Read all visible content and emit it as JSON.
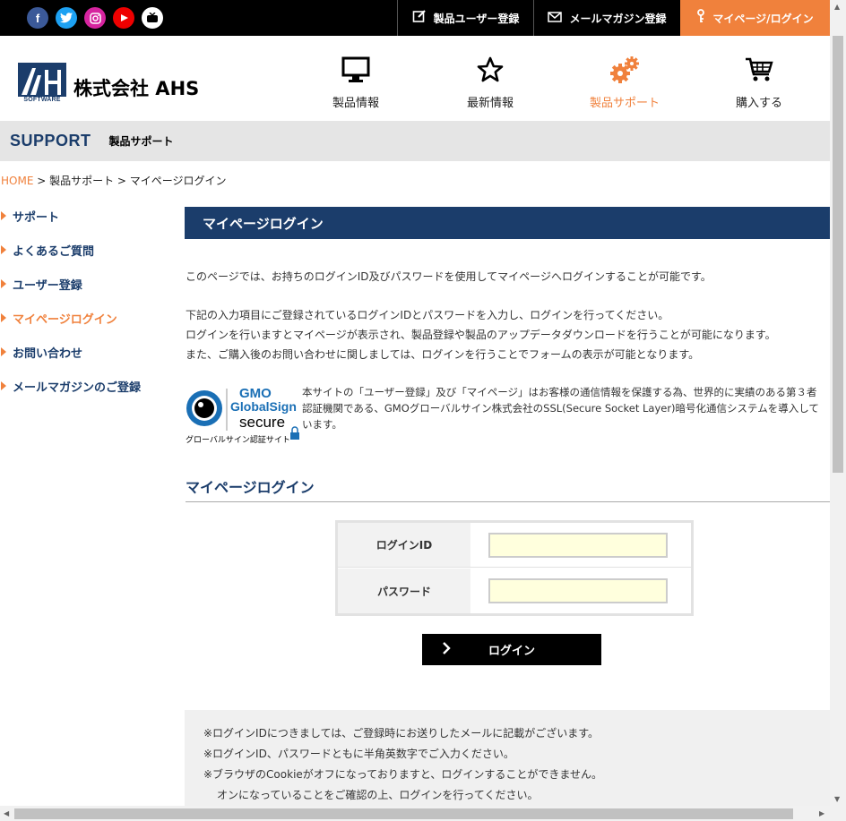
{
  "topbar": {
    "social": [
      "f",
      "t",
      "ig",
      "yt",
      "nc"
    ],
    "product_register": "製品ユーザー登録",
    "mail_register": "メールマガジン登録",
    "mypage_login": "マイページ/ログイン"
  },
  "header": {
    "logo_sub": "SOFTWARE",
    "logo_text": "株式会社 AHS",
    "nav": [
      {
        "label": "製品情報",
        "icon": "monitor-icon"
      },
      {
        "label": "最新情報",
        "icon": "star-icon"
      },
      {
        "label": "製品サポート",
        "icon": "gears-icon",
        "active": true
      },
      {
        "label": "購入する",
        "icon": "cart-icon"
      }
    ]
  },
  "band": {
    "en": "SUPPORT",
    "jp": "製品サポート"
  },
  "breadcrumb": {
    "home": "HOME",
    "sep": " > ",
    "support": "製品サポート",
    "current": "マイページログイン"
  },
  "sidebar": [
    {
      "label": "サポート"
    },
    {
      "label": "よくあるご質問"
    },
    {
      "label": "ユーザー登録"
    },
    {
      "label": "マイページログイン",
      "active": true
    },
    {
      "label": "お問い合わせ"
    },
    {
      "label": "メールマガジンのご登録"
    }
  ],
  "main": {
    "title": "マイページログイン",
    "intro": "このページでは、お持ちのログインID及びパスワードを使用してマイページへログインすることが可能です。",
    "para2": [
      "下記の入力項目にご登録されているログインIDとパスワードを入力し、ログインを行ってください。",
      "ログインを行いますとマイページが表示され、製品登録や製品のアップデータダウンロードを行うことが可能になります。",
      "また、ご購入後のお問い合わせに関しましては、ログインを行うことでフォームの表示が可能となります。"
    ],
    "globalsign": {
      "gmo": "GMO",
      "brand": "GlobalSign",
      "secure": "secure",
      "caption": "グローバルサイン認証サイト",
      "text": "本サイトの「ユーザー登録」及び「マイページ」はお客様の通信情報を保護する為、世界的に実績のある第３者認証機関である、GMOグローバルサイン株式会社のSSL(Secure Socket Layer)暗号化通信システムを導入しています。"
    },
    "form_heading": "マイページログイン",
    "form": {
      "id_label": "ログインID",
      "id_value": "",
      "pw_label": "パスワード",
      "pw_value": ""
    },
    "login_button": "ログイン",
    "notes": [
      "※ログインIDにつきましては、ご登録時にお送りしたメールに記載がございます。",
      "※ログインID、パスワードともに半角英数字でご入力ください。",
      "※ブラウザのCookieがオフになっておりますと、ログインすることができません。",
      "オンになっていることをご確認の上、ログインを行ってください。"
    ]
  },
  "colors": {
    "navy": "#1b3d6b",
    "accent": "#f0813c",
    "input_bg": "#ffffdd"
  }
}
